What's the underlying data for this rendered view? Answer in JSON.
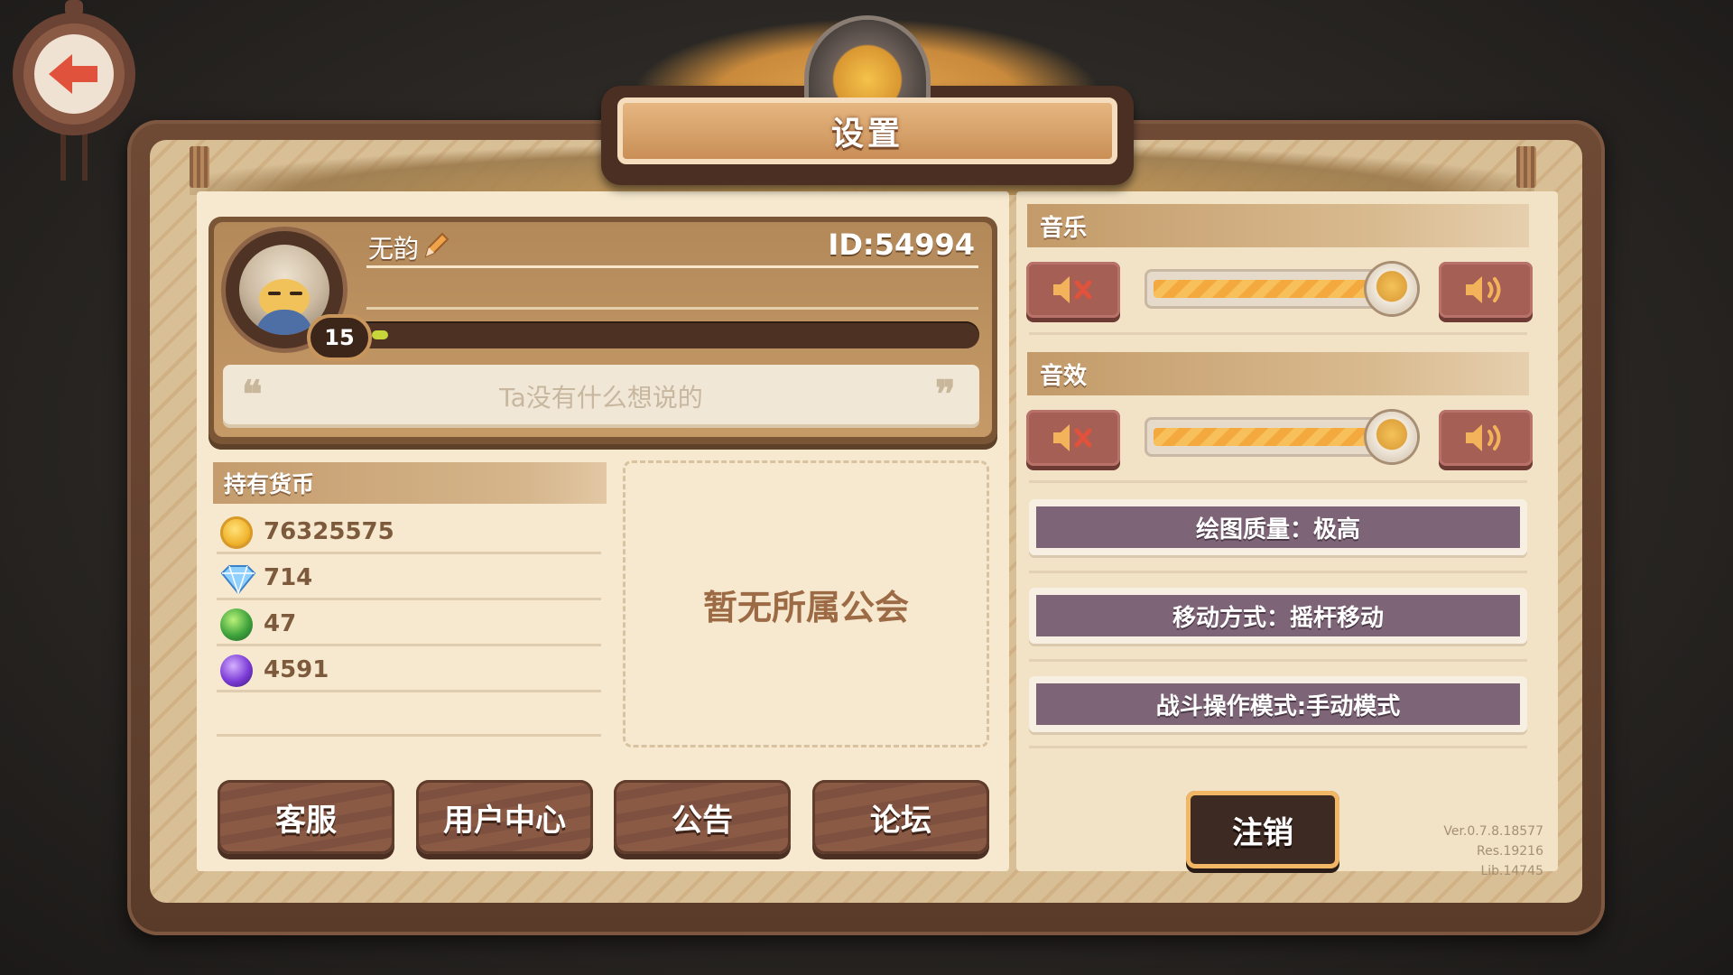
{
  "title": "设置",
  "profile": {
    "name": "无韵",
    "id": "ID:54994",
    "level": "15",
    "xp_fraction": 0.01,
    "motto_placeholder": "Ta没有什么想说的"
  },
  "currency": {
    "header": "持有货币",
    "items": [
      {
        "icon": "gold-coin-icon",
        "value": "76325575"
      },
      {
        "icon": "diamond-icon",
        "value": "714"
      },
      {
        "icon": "green-orb-icon",
        "value": "47"
      },
      {
        "icon": "purple-orb-icon",
        "value": "4591"
      }
    ]
  },
  "guild": {
    "empty_text": "暂无所属公会"
  },
  "buttons": {
    "customer_service": "客服",
    "user_center": "用户中心",
    "announcement": "公告",
    "forum": "论坛",
    "logout": "注销"
  },
  "audio": {
    "music_label": "音乐",
    "music_level": 1.0,
    "sfx_label": "音效",
    "sfx_level": 1.0
  },
  "options": {
    "graphics": "绘图质量：极高",
    "movement": "移动方式：摇杆移动",
    "combat": "战斗操作模式:手动模式"
  },
  "version": {
    "ver": "Ver.0.7.8.18577",
    "res": "Res.19216",
    "lib": "Lib.14745"
  },
  "colors": {
    "accent_gold": "#f3a93d",
    "button_red": "#a65f54",
    "option_purple": "#7e6477"
  }
}
